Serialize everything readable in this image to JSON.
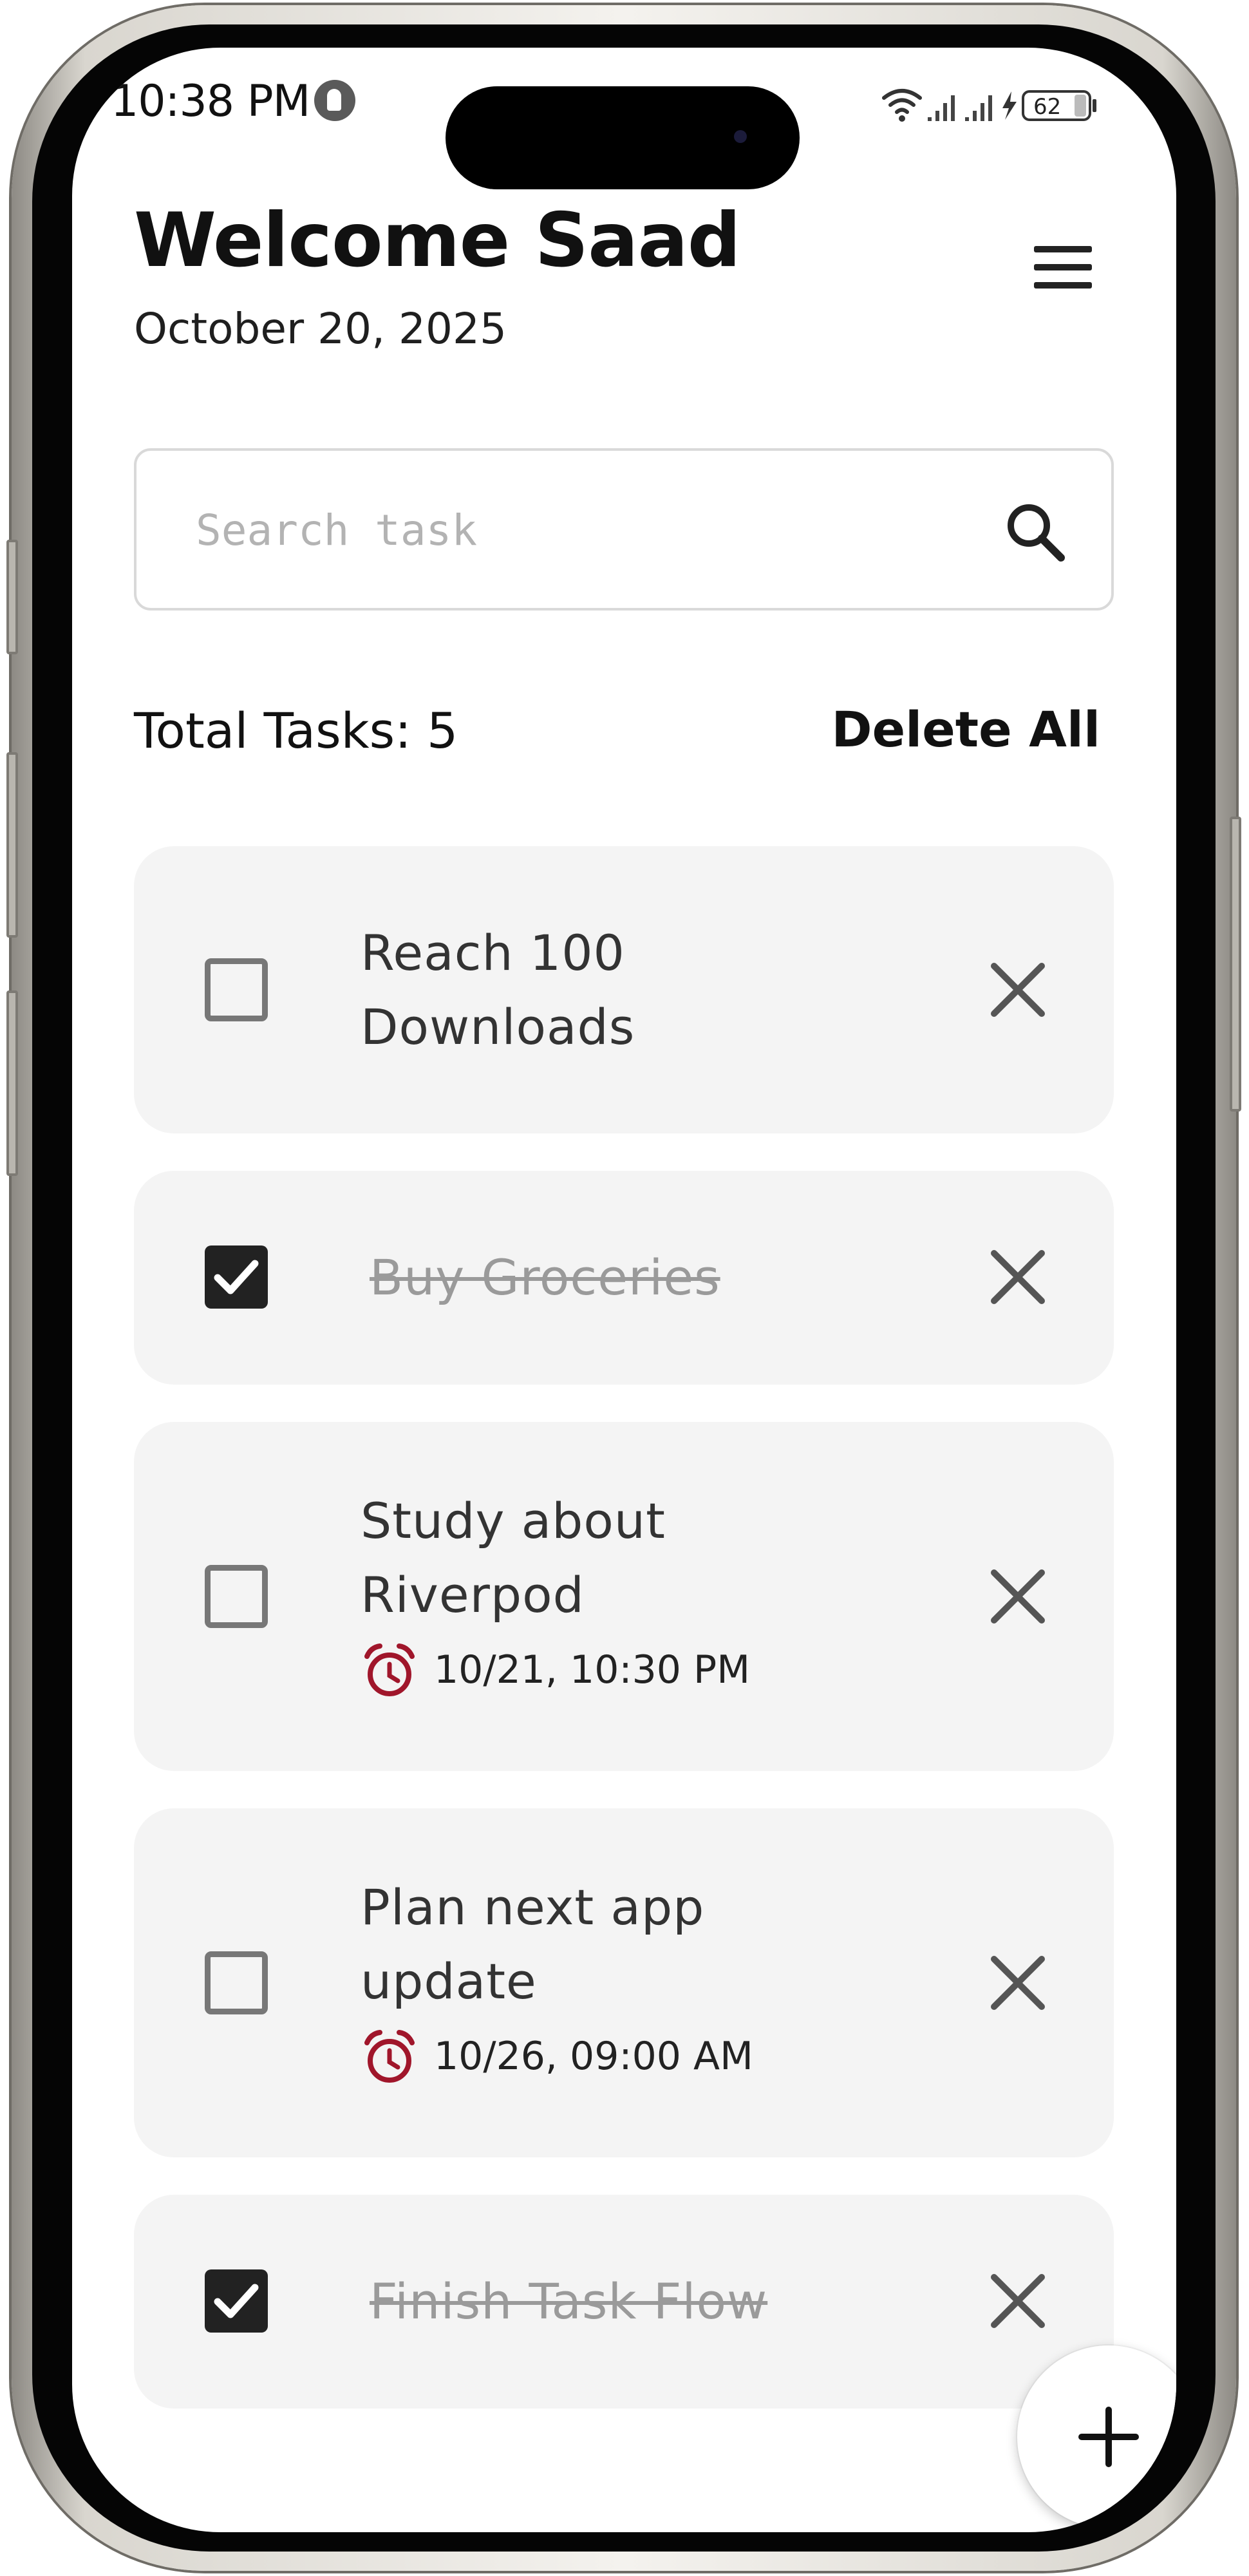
{
  "status_bar": {
    "time": "10:38 PM",
    "battery": "62",
    "icons": [
      "wifi-icon",
      "signal-icon",
      "signal-icon",
      "charging-icon",
      "battery-icon"
    ]
  },
  "header": {
    "title": "Welcome Saad",
    "date": "October 20, 2025",
    "menu_icon": "hamburger-menu-icon"
  },
  "search": {
    "placeholder": "Search task",
    "value": "",
    "icon": "search-icon"
  },
  "summary": {
    "total_label": "Total Tasks: 5",
    "delete_all_label": "Delete All"
  },
  "tasks": [
    {
      "title_line1": "Reach 100",
      "title_line2": "Downloads",
      "completed": false,
      "due": ""
    },
    {
      "title_line1": "Buy Groceries",
      "title_line2": "",
      "completed": true,
      "due": ""
    },
    {
      "title_line1": "Study about",
      "title_line2": "Riverpod",
      "completed": false,
      "due": "10/21, 10:30 PM"
    },
    {
      "title_line1": "Plan next app",
      "title_line2": "update",
      "completed": false,
      "due": "10/26, 09:00 AM"
    },
    {
      "title_line1": "Finish Task Flow",
      "title_line2": "",
      "completed": true,
      "due": ""
    }
  ],
  "fab": {
    "icon": "plus-icon"
  },
  "colors": {
    "card_background": "#f4f4f4",
    "checkbox_checked": "#222222",
    "alarm_icon": "#a0162b",
    "completed_text": "#9a9a9a"
  }
}
